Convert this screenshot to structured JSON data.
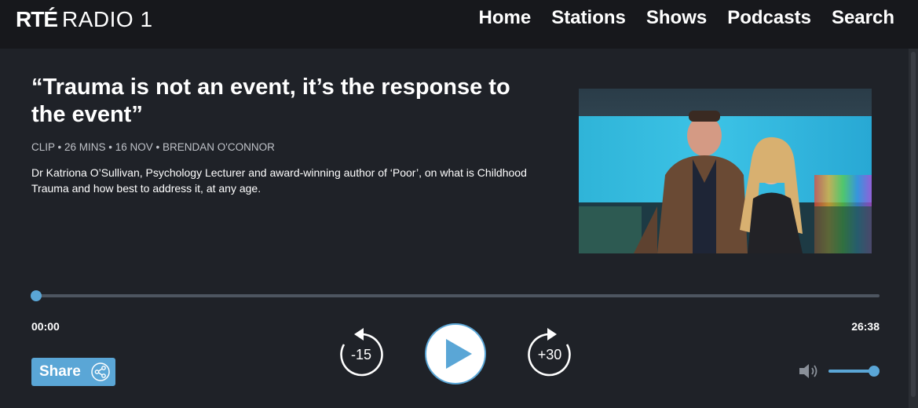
{
  "header": {
    "logo_rte": "RTÉ",
    "logo_radio": "RADIO 1",
    "nav": [
      {
        "label": "Home"
      },
      {
        "label": "Stations"
      },
      {
        "label": "Shows"
      },
      {
        "label": "Podcasts"
      },
      {
        "label": "Search"
      }
    ]
  },
  "clip": {
    "title": "“Trauma is not an event, it’s the response to the event”",
    "meta": "CLIP • 26 MINS • 16 NOV • BRENDAN O'CONNOR",
    "description": "Dr Katriona O’Sullivan, Psychology Lecturer and award-winning author of ‘Poor’, on what is Childhood Trauma and how best to address it, at any age."
  },
  "player": {
    "elapsed": "00:00",
    "total": "26:38",
    "progress_fraction": 0.0,
    "rewind_label": "-15",
    "forward_label": "+30",
    "share_label": "Share",
    "volume_fraction": 1.0
  },
  "colors": {
    "background": "#1f2228",
    "header": "#17181c",
    "accent": "#5aa6d6",
    "track": "#4d5560",
    "meta_text": "#bfc2c8"
  },
  "icons": {
    "play": "play-icon",
    "rewind": "rewind-15-icon",
    "forward": "forward-30-icon",
    "share": "share-icon",
    "volume": "volume-icon"
  }
}
